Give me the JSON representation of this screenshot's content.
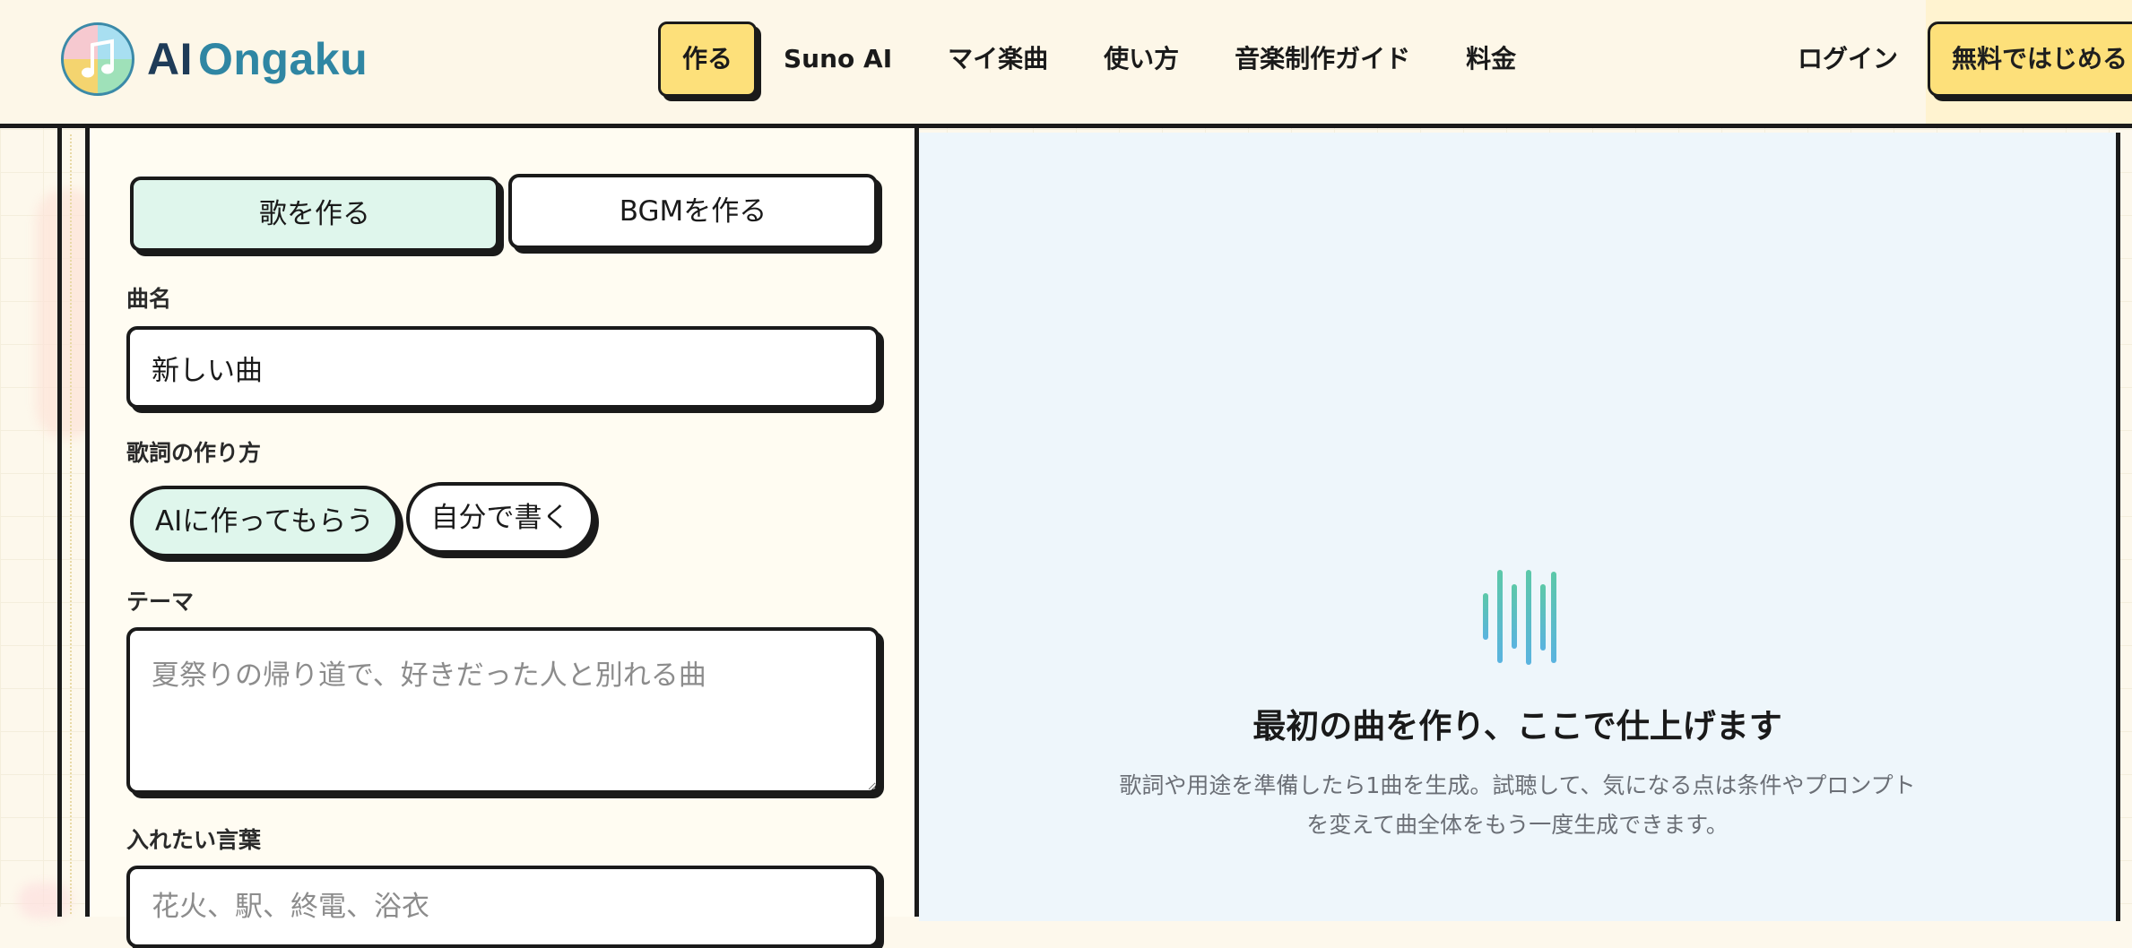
{
  "brand": {
    "logo_part1": "AI",
    "logo_part2": "Ongaku"
  },
  "nav": {
    "items": [
      {
        "label": "作る",
        "active": true
      },
      {
        "label": "Suno AI"
      },
      {
        "label": "マイ楽曲"
      },
      {
        "label": "使い方"
      },
      {
        "label": "音楽制作ガイド"
      },
      {
        "label": "料金"
      }
    ],
    "login": "ログイン",
    "cta": "無料ではじめる"
  },
  "form": {
    "mode_tabs": [
      {
        "label": "歌を作る",
        "selected": true
      },
      {
        "label": "BGMを作る",
        "selected": false
      }
    ],
    "song_title": {
      "label": "曲名",
      "value": "新しい曲"
    },
    "lyrics_method": {
      "label": "歌詞の作り方",
      "options": [
        {
          "label": "AIに作ってもらう",
          "selected": true
        },
        {
          "label": "自分で書く",
          "selected": false
        }
      ]
    },
    "theme": {
      "label": "テーマ",
      "placeholder": "夏祭りの帰り道で、好きだった人と別れる曲"
    },
    "keywords": {
      "label": "入れたい言葉",
      "placeholder": "花火、駅、終電、浴衣"
    }
  },
  "preview": {
    "icon": "soundwave-icon",
    "title": "最初の曲を作り、ここで仕上げます",
    "description_line1": "歌詞や用途を準備したら1曲を生成。試聴して、気になる点は条件やプロンプト",
    "description_line2": "を変えて曲全体をもう一度生成できます。"
  },
  "colors": {
    "accent_yellow": "#fde07a",
    "selected_mint": "#dff6ec",
    "brand_blue": "#2f86a3",
    "preview_bg": "#eef6fb"
  }
}
